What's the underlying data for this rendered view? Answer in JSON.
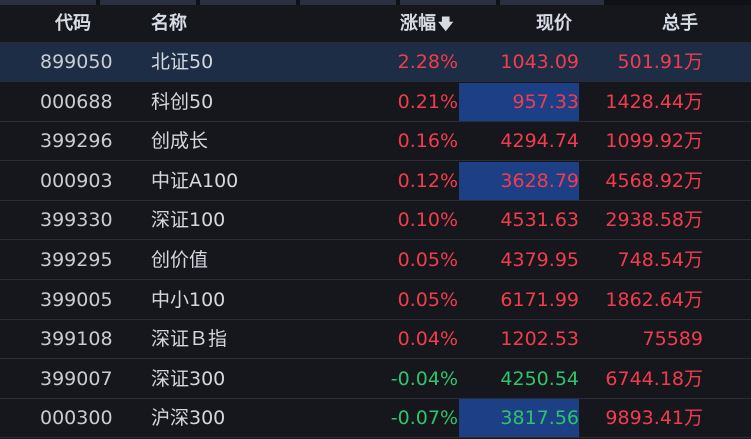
{
  "header": {
    "code": "代码",
    "name": "名称",
    "change": "涨幅",
    "sort_icon": "arrow-down-icon",
    "price": "现价",
    "volume": "总手"
  },
  "colors": {
    "up": "#f23c4e",
    "down": "#2fc36a",
    "highlight": "#1c3f86",
    "selected_row": "#1d2d45"
  },
  "rows": [
    {
      "code": "899050",
      "name": "北证50",
      "change": "2.28%",
      "price": "1043.09",
      "volume": "501.91万",
      "dir": "up",
      "vol_dir": "up",
      "price_dir": "up",
      "highlight": false,
      "selected": true
    },
    {
      "code": "000688",
      "name": "科创50",
      "change": "0.21%",
      "price": "957.33",
      "volume": "1428.44万",
      "dir": "up",
      "vol_dir": "up",
      "price_dir": "up",
      "highlight": true,
      "selected": false
    },
    {
      "code": "399296",
      "name": "创成长",
      "change": "0.16%",
      "price": "4294.74",
      "volume": "1099.92万",
      "dir": "up",
      "vol_dir": "up",
      "price_dir": "up",
      "highlight": false,
      "selected": false
    },
    {
      "code": "000903",
      "name": "中证A100",
      "change": "0.12%",
      "price": "3628.79",
      "volume": "4568.92万",
      "dir": "up",
      "vol_dir": "up",
      "price_dir": "up",
      "highlight": true,
      "selected": false
    },
    {
      "code": "399330",
      "name": "深证100",
      "change": "0.10%",
      "price": "4531.63",
      "volume": "2938.58万",
      "dir": "up",
      "vol_dir": "up",
      "price_dir": "up",
      "highlight": false,
      "selected": false
    },
    {
      "code": "399295",
      "name": "创价值",
      "change": "0.05%",
      "price": "4379.95",
      "volume": "748.54万",
      "dir": "up",
      "vol_dir": "up",
      "price_dir": "up",
      "highlight": false,
      "selected": false
    },
    {
      "code": "399005",
      "name": "中小100",
      "change": "0.05%",
      "price": "6171.99",
      "volume": "1862.64万",
      "dir": "up",
      "vol_dir": "up",
      "price_dir": "up",
      "highlight": false,
      "selected": false
    },
    {
      "code": "399108",
      "name": "深证Ｂ指",
      "change": "0.04%",
      "price": "1202.53",
      "volume": "75589",
      "dir": "up",
      "vol_dir": "up",
      "price_dir": "up",
      "highlight": false,
      "selected": false
    },
    {
      "code": "399007",
      "name": "深证300",
      "change": "-0.04%",
      "price": "4250.54",
      "volume": "6744.18万",
      "dir": "down",
      "vol_dir": "up",
      "price_dir": "down",
      "highlight": false,
      "selected": false
    },
    {
      "code": "000300",
      "name": "沪深300",
      "change": "-0.07%",
      "price": "3817.56",
      "volume": "9893.41万",
      "dir": "down",
      "vol_dir": "up",
      "price_dir": "down",
      "highlight": true,
      "selected": false
    }
  ]
}
